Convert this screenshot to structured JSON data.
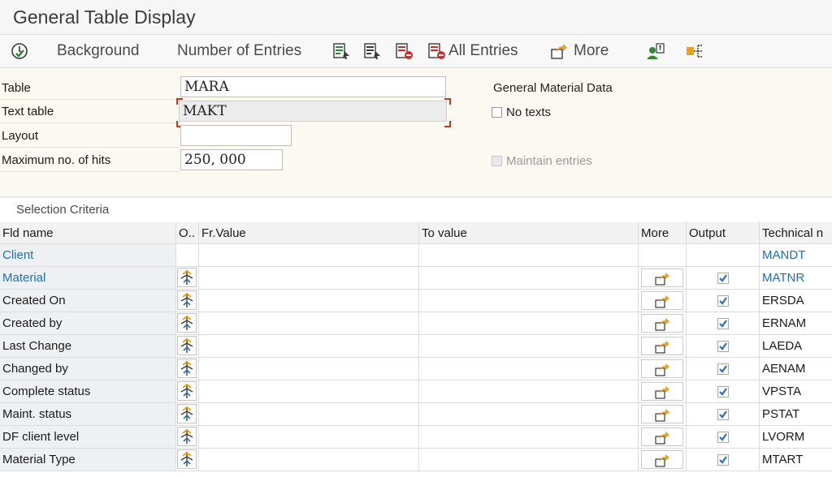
{
  "window": {
    "title": "General Table Display"
  },
  "toolbar": {
    "background_label": "Background",
    "entries_label": "Number of Entries",
    "all_entries_label": "All Entries",
    "more_label": "More"
  },
  "params": {
    "table_label": "Table",
    "table_value": "MARA",
    "table_desc": "General Material Data",
    "text_table_label": "Text table",
    "text_table_value": "MAKT",
    "no_texts_label": "No texts",
    "layout_label": "Layout",
    "layout_value": "",
    "max_hits_label": "Maximum no. of hits",
    "max_hits_value": "250, 000",
    "maintain_label": "Maintain entries"
  },
  "selection": {
    "title": "Selection Criteria",
    "columns": {
      "fld": "Fld name",
      "op": "O..",
      "from": "Fr.Value",
      "to": "To value",
      "more": "More",
      "output": "Output",
      "tech": "Technical n"
    },
    "rows": [
      {
        "name": "Client",
        "tech": "MANDT",
        "link": true,
        "selectable": false
      },
      {
        "name": "Material",
        "tech": "MATNR",
        "link": true,
        "selectable": true
      },
      {
        "name": "Created On",
        "tech": "ERSDA",
        "link": false,
        "selectable": true
      },
      {
        "name": "Created by",
        "tech": "ERNAM",
        "link": false,
        "selectable": true
      },
      {
        "name": "Last Change",
        "tech": "LAEDA",
        "link": false,
        "selectable": true
      },
      {
        "name": "Changed by",
        "tech": "AENAM",
        "link": false,
        "selectable": true
      },
      {
        "name": "Complete status",
        "tech": "VPSTA",
        "link": false,
        "selectable": true
      },
      {
        "name": "Maint. status",
        "tech": "PSTAT",
        "link": false,
        "selectable": true
      },
      {
        "name": "DF client level",
        "tech": "LVORM",
        "link": false,
        "selectable": true
      },
      {
        "name": "Material Type",
        "tech": "MTART",
        "link": false,
        "selectable": true
      }
    ]
  },
  "colors": {
    "link": "#1f6fb3",
    "accent_orange": "#e8a317",
    "check_blue": "#2a6fb8",
    "green_icon": "#2e8b2e",
    "red_icon": "#c9302c"
  },
  "icons": [
    "execute-icon",
    "report-icon",
    "report-select-icon",
    "delete-row-icon",
    "all-entries-icon",
    "more-icon",
    "user-settings-icon",
    "hierarchy-icon",
    "selection-options-icon",
    "more-arrow-icon",
    "checkbox-checked-icon"
  ]
}
